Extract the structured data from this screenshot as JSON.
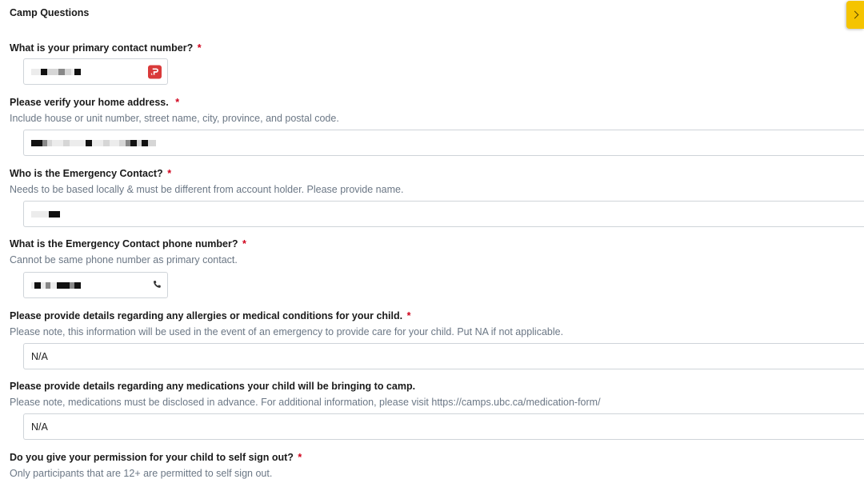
{
  "section": {
    "title": "Camp Questions"
  },
  "questions": [
    {
      "label": "What is your primary contact number?",
      "required": "*",
      "help": "",
      "value": ""
    },
    {
      "label": "Please verify your home address.",
      "required": "*",
      "help": "Include house or unit number, street name, city, province, and postal code.",
      "value": ""
    },
    {
      "label": "Who is the Emergency Contact?",
      "required": "*",
      "help": "Needs to be based locally & must be different from account holder. Please provide name.",
      "value": ""
    },
    {
      "label": "What is the Emergency Contact phone number?",
      "required": "*",
      "help": "Cannot be same phone number as primary contact.",
      "value": ""
    },
    {
      "label": "Please provide details regarding any allergies or medical conditions for your child.",
      "required": "*",
      "help": "Please note, this information will be used in the event of an emergency to provide care for your child. Put NA if not applicable.",
      "value": "N/A"
    },
    {
      "label": "Please provide details regarding any medications your child will be bringing to camp.",
      "required": "",
      "help": "Please note, medications must be disclosed in advance. For additional information, please visit https://camps.ubc.ca/medication-form/",
      "value": "N/A"
    },
    {
      "label": "Do you give your permission for your child to self sign out?",
      "required": "*",
      "help": "Only participants that are 12+ are permitted to self sign out."
    }
  ],
  "icons": {
    "side_tab": "chevron-right-icon",
    "phone": "phone-icon",
    "autofill_extension": "autofill-extension-icon"
  },
  "colors": {
    "required": "#d0021b",
    "help_text": "#6b7785",
    "side_tab": "#f5c400",
    "extension_icon": "#d93a3a"
  }
}
